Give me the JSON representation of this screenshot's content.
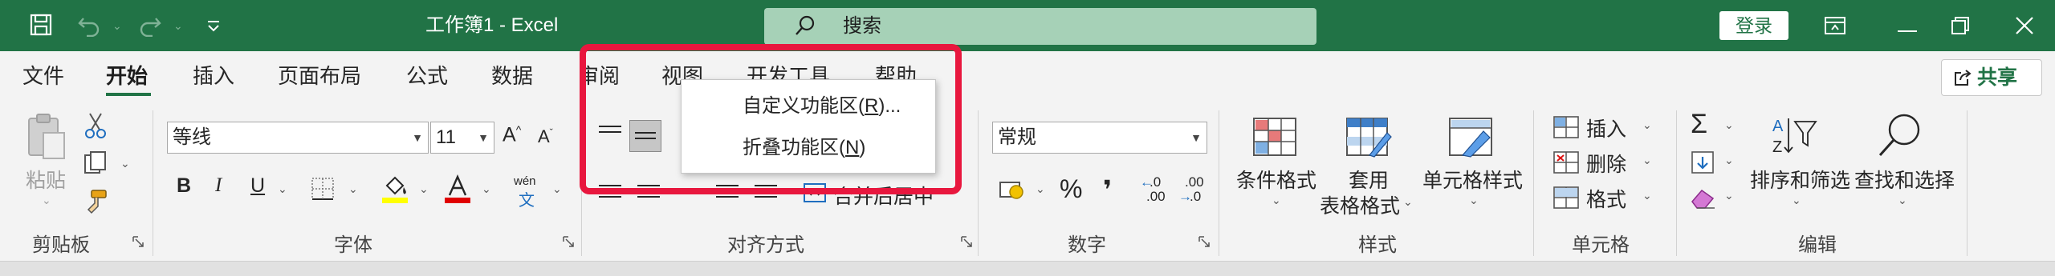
{
  "colors": {
    "brand": "#217346",
    "highlight": "#e8173e"
  },
  "titlebar": {
    "title": "工作簿1  -  Excel",
    "search_placeholder": "搜索",
    "login_label": "登录",
    "icons": [
      "save-icon",
      "undo-icon",
      "redo-icon",
      "customize-quick-access-icon",
      "search-icon",
      "ribbon-display-icon",
      "minimize-icon",
      "restore-icon",
      "close-icon"
    ]
  },
  "tabs": [
    {
      "label": "文件"
    },
    {
      "label": "开始"
    },
    {
      "label": "插入"
    },
    {
      "label": "页面布局"
    },
    {
      "label": "公式"
    },
    {
      "label": "数据"
    },
    {
      "label": "审阅"
    },
    {
      "label": "视图"
    },
    {
      "label": "开发工具"
    },
    {
      "label": "帮助"
    }
  ],
  "active_tab": "开始",
  "share_label": "共享",
  "ribbon": {
    "clipboard": {
      "paste": "粘贴",
      "label": "剪贴板"
    },
    "font": {
      "font_name": "等线",
      "font_size": "11",
      "bold": "B",
      "italic": "I",
      "underline": "U",
      "wen": "wén",
      "wen2": "文",
      "label": "字体"
    },
    "alignment": {
      "merge": "合并后居中",
      "label": "对齐方式"
    },
    "number": {
      "format": "常规",
      "percent": "%",
      "comma": "❜",
      "dec_inc": ".00",
      "dec_inc2": ".0",
      "dec_dec": ".00",
      "dec_dec2": ".0",
      "label": "数字"
    },
    "styles": {
      "conditional": "条件格式",
      "table1": "套用",
      "table2": "表格格式",
      "cell_styles": "单元格样式",
      "label": "样式"
    },
    "cells": {
      "insert": "插入",
      "delete": "删除",
      "format": "格式",
      "label": "单元格"
    },
    "editing": {
      "sort": "排序和筛选",
      "find": "查找和选择",
      "label": "编辑"
    }
  },
  "context_menu": [
    {
      "label": "自定义功能区(",
      "key": "R",
      "suffix": ")..."
    },
    {
      "label": "折叠功能区(",
      "key": "N",
      "suffix": ")"
    }
  ]
}
